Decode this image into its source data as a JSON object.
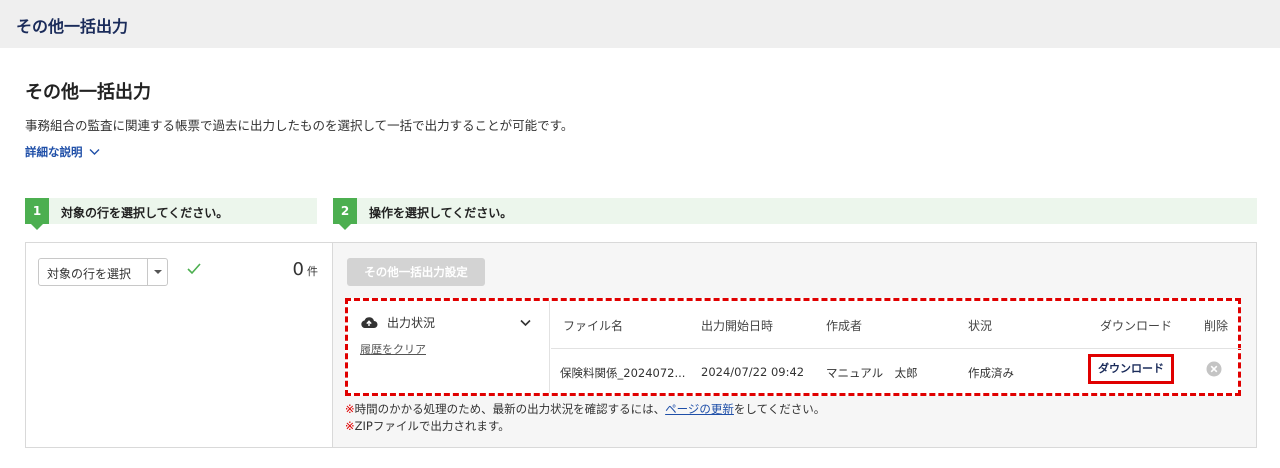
{
  "header": {
    "title": "その他一括出力"
  },
  "page": {
    "title": "その他一括出力",
    "description": "事務組合の監査に関連する帳票で過去に出力したものを選択して一括で出力することが可能です。",
    "detail_link": "詳細な説明"
  },
  "steps": [
    {
      "number": "1",
      "label": "対象の行を選択してください。"
    },
    {
      "number": "2",
      "label": "操作を選択してください。"
    }
  ],
  "left_panel": {
    "select_label": "対象の行を選択",
    "count": "0",
    "count_unit": "件"
  },
  "right_panel": {
    "settings_button": "その他一括出力設定",
    "status": {
      "title": "出力状況",
      "clear_link": "履歴をクリア",
      "columns": [
        "ファイル名",
        "出力開始日時",
        "作成者",
        "状況",
        "ダウンロード",
        "削除"
      ],
      "rows": [
        {
          "file_name": "保険料関係_2024072...",
          "started_at": "2024/07/22 09:42",
          "creator": "マニュアル　太郎",
          "state": "作成済み",
          "download_label": "ダウンロード"
        }
      ]
    },
    "notes": {
      "mark": "※",
      "note1_before": "時間のかかる処理のため、最新の出力状況を確認するには、",
      "note1_link": "ページの更新",
      "note1_after": "をしてください。",
      "note2": "ZIPファイルで出力されます。"
    }
  },
  "colors": {
    "accent_green": "#4caf50",
    "highlight_red": "#e00000",
    "link_blue": "#1f4fa8"
  },
  "icons": [
    "chevron-down-icon",
    "check-icon",
    "cloud-upload-icon",
    "close-circle-icon"
  ]
}
